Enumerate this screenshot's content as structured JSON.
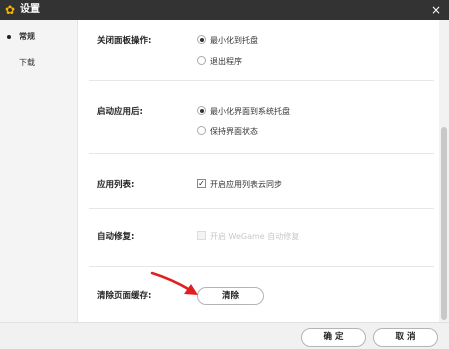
{
  "window": {
    "title": "设置",
    "icon": "gear-icon",
    "close_glyph": "×"
  },
  "sidebar": {
    "items": [
      {
        "label": "常规",
        "active": true
      },
      {
        "label": "下载",
        "active": false
      }
    ]
  },
  "settings": {
    "close_panel": {
      "label": "关闭面板操作:",
      "options": [
        {
          "label": "最小化到托盘",
          "checked": true
        },
        {
          "label": "退出程序",
          "checked": false
        }
      ]
    },
    "after_launch": {
      "label": "启动应用后:",
      "options": [
        {
          "label": "最小化界面到系统托盘",
          "checked": true
        },
        {
          "label": "保持界面状态",
          "checked": false
        }
      ]
    },
    "app_list": {
      "label": "应用列表:",
      "checkbox_label": "开启应用列表云同步",
      "checked": true
    },
    "auto_repair": {
      "label": "自动修复:",
      "checkbox_label": "开启 WeGame 自动修复",
      "checked": false,
      "disabled": true
    },
    "clear_cache": {
      "label": "清除页面缓存:",
      "button_label": "清除"
    }
  },
  "footer": {
    "ok_label": "确 定",
    "cancel_label": "取 消"
  },
  "colors": {
    "titlebar": "#333333",
    "accent_icon": "#f5b400",
    "arrow": "#e02020"
  }
}
